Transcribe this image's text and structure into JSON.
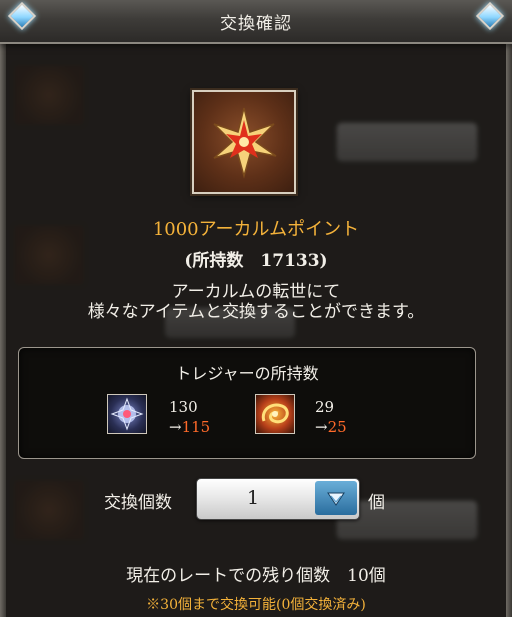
{
  "header": {
    "title": "交換確認"
  },
  "item": {
    "icon": "arcanum-star-icon",
    "name": "1000アーカルムポイント",
    "owned_line": "(所持数　17133)"
  },
  "description": {
    "line1": "アーカルムの転世にて",
    "line2": "様々なアイテムと交換することができます。"
  },
  "treasure": {
    "title": "トレジャーの所持数",
    "items": [
      {
        "icon": "blue-crystal-treasure-icon",
        "current": "130",
        "after": "115"
      },
      {
        "icon": "fire-swirl-treasure-icon",
        "current": "29",
        "after": "25"
      }
    ]
  },
  "exchange": {
    "label": "交換個数",
    "value": "1",
    "unit": "個"
  },
  "remaining_text": "現在のレートでの残り個数　10個",
  "note": "※30個まで交換可能(0個交換済み)",
  "colors": {
    "accent_gold": "#f4b23a",
    "after_value": "#ff6a2a"
  }
}
